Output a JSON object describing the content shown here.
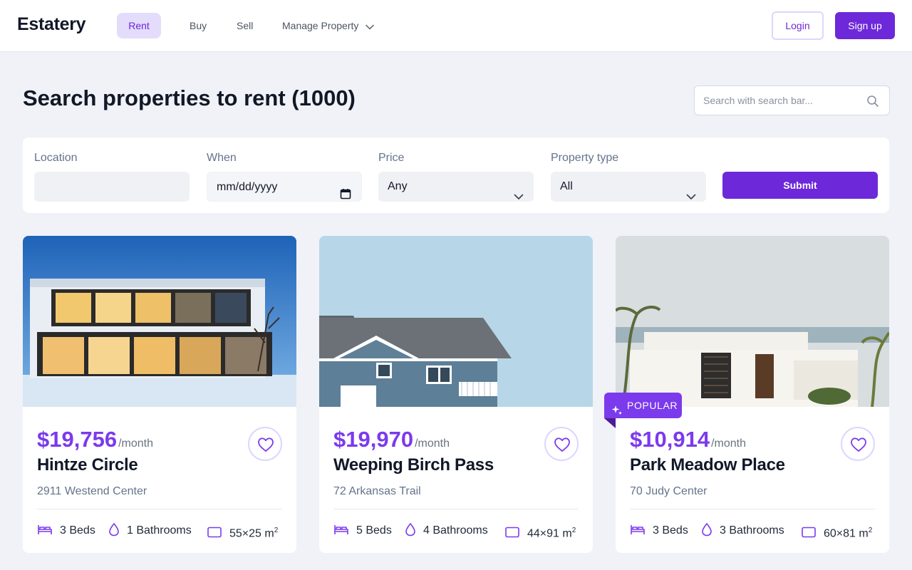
{
  "header": {
    "logo": "Estatery",
    "nav": [
      {
        "label": "Rent",
        "active": true
      },
      {
        "label": "Buy"
      },
      {
        "label": "Sell"
      },
      {
        "label": "Manage Property",
        "icon": "chevron-down-icon"
      }
    ],
    "login_label": "Login",
    "signup_label": "Sign up"
  },
  "page": {
    "title": "Search properties to rent (1000)",
    "search_placeholder": "Search with search bar...",
    "search_icon": "search-icon"
  },
  "filters": {
    "location": {
      "label": "Location",
      "value": ""
    },
    "when": {
      "label": "When",
      "value": "mm/dd/yyyy",
      "icon": "calendar-icon"
    },
    "price": {
      "label": "Price",
      "value": "Any",
      "icon": "chevron-down-icon"
    },
    "property_type": {
      "label": "Property type",
      "value": "All",
      "icon": "chevron-down-icon"
    },
    "submit_label": "Submit"
  },
  "listings": [
    {
      "price": "$19,756",
      "period": "/month",
      "name": "Hintze Circle",
      "address": "2911 Westend Center",
      "beds": "3 Beds",
      "baths": "1 Bathrooms",
      "area": "55×25 m",
      "area_unit_exp": "2",
      "popular": false
    },
    {
      "price": "$19,970",
      "period": "/month",
      "name": "Weeping Birch Pass",
      "address": "72 Arkansas Trail",
      "beds": "5 Beds",
      "baths": "4 Bathrooms",
      "area": "44×91 m",
      "area_unit_exp": "2",
      "popular": false
    },
    {
      "price": "$10,914",
      "period": "/month",
      "name": "Park Meadow Place",
      "address": "70 Judy Center",
      "beds": "3 Beds",
      "baths": "3 Bathrooms",
      "area": "60×81 m",
      "area_unit_exp": "2",
      "popular": true,
      "badge": "POPULAR"
    }
  ],
  "colors": {
    "accent": "#7c3aed",
    "accent_dark": "#6d28d9",
    "accent_light": "#e3dcfb",
    "background": "#f0f2f7"
  }
}
